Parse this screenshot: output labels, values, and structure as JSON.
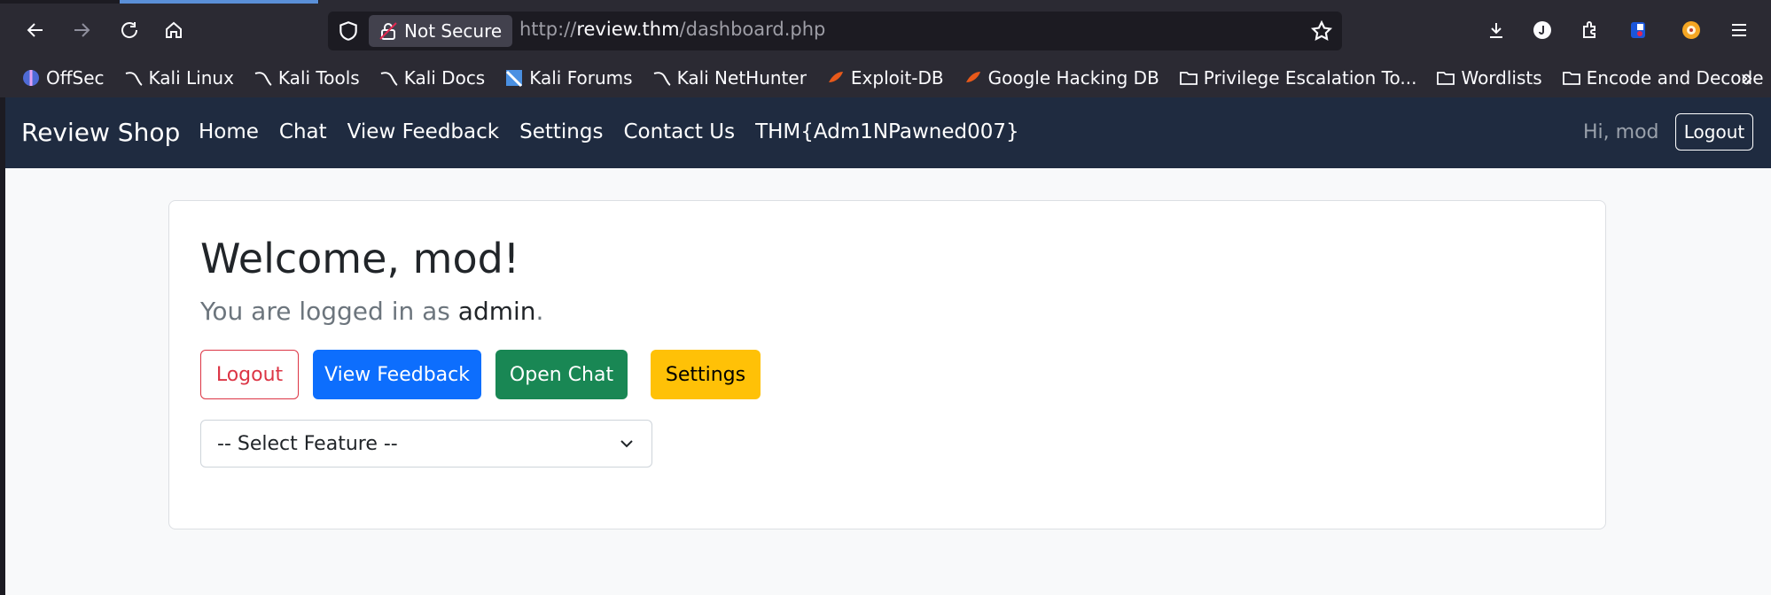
{
  "browser": {
    "security_label": "Not Secure",
    "url_scheme": "http://",
    "url_host": "review.thm",
    "url_path": "/dashboard.php",
    "bookmarks": [
      {
        "label": "OffSec",
        "icon": "offsec-icon"
      },
      {
        "label": "Kali Linux",
        "icon": "kali-dragon-icon"
      },
      {
        "label": "Kali Tools",
        "icon": "kali-dragon-icon"
      },
      {
        "label": "Kali Docs",
        "icon": "kali-dragon-icon"
      },
      {
        "label": "Kali Forums",
        "icon": "kali-forums-icon"
      },
      {
        "label": "Kali NetHunter",
        "icon": "kali-dragon-icon"
      },
      {
        "label": "Exploit-DB",
        "icon": "exploit-db-icon"
      },
      {
        "label": "Google Hacking DB",
        "icon": "exploit-db-icon"
      },
      {
        "label": "Privilege Escalation To...",
        "icon": "folder-icon"
      },
      {
        "label": "Wordlists",
        "icon": "folder-icon"
      },
      {
        "label": "Encode and Decode",
        "icon": "folder-icon"
      }
    ]
  },
  "navbar": {
    "brand": "Review Shop",
    "links": [
      "Home",
      "Chat",
      "View Feedback",
      "Settings",
      "Contact Us",
      "THM{Adm1NPawned007}"
    ],
    "greeting": "Hi, mod",
    "logout_label": "Logout"
  },
  "card": {
    "title": "Welcome, mod!",
    "subtitle_prefix": "You are logged in as ",
    "subtitle_role": "admin",
    "subtitle_suffix": ".",
    "buttons": {
      "logout": "Logout",
      "view_feedback": "View Feedback",
      "open_chat": "Open Chat",
      "settings": "Settings"
    },
    "select_value": "-- Select Feature --"
  },
  "colors": {
    "navbar_bg": "#1f2b40",
    "danger": "#dc3545",
    "primary": "#0d6efd",
    "success": "#198754",
    "warning": "#ffc107"
  }
}
